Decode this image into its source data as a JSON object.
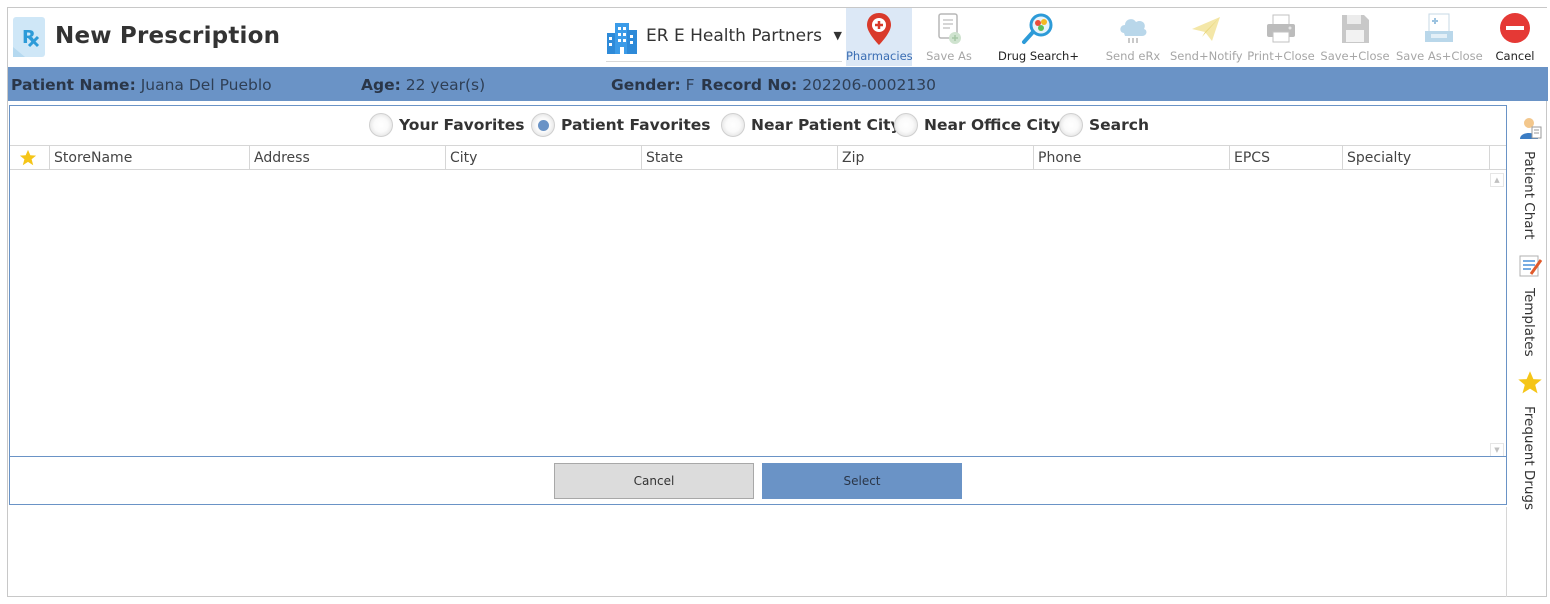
{
  "header": {
    "title": "New Prescription",
    "practice": "ER E Health Partners"
  },
  "toolbar": [
    {
      "label": "Pharmacies",
      "icon": "pharmacy-pin-icon",
      "state": "active"
    },
    {
      "label": "Save As",
      "icon": "save-as-document-icon",
      "state": "disabled"
    },
    {
      "label": "Drug Search+",
      "icon": "drug-search-icon",
      "state": "enabled"
    },
    {
      "label": "Send eRx",
      "icon": "send-erx-cloud-icon",
      "state": "disabled"
    },
    {
      "label": "Send+Notify",
      "icon": "paper-plane-icon",
      "state": "disabled"
    },
    {
      "label": "Print+Close",
      "icon": "printer-icon",
      "state": "disabled"
    },
    {
      "label": "Save+Close",
      "icon": "floppy-disk-icon",
      "state": "disabled"
    },
    {
      "label": "Save As+Close",
      "icon": "save-as-close-icon",
      "state": "disabled"
    },
    {
      "label": "Cancel",
      "icon": "cancel-icon",
      "state": "enabled"
    }
  ],
  "patient": {
    "name_label": "Patient Name:",
    "name": "Juana Del Pueblo",
    "age_label": "Age:",
    "age": "22 year(s)",
    "gender_label": "Gender:",
    "gender": "F",
    "record_label": "Record No:",
    "record": "202206-0002130"
  },
  "filters": [
    {
      "label": "Your Favorites",
      "checked": false
    },
    {
      "label": "Patient Favorites",
      "checked": true
    },
    {
      "label": "Near Patient City",
      "checked": false
    },
    {
      "label": "Near Office City",
      "checked": false
    },
    {
      "label": "Search",
      "checked": false
    }
  ],
  "table": {
    "columns": [
      "StoreName",
      "Address",
      "City",
      "State",
      "Zip",
      "Phone",
      "EPCS",
      "Specialty"
    ],
    "rows": []
  },
  "actions": {
    "cancel": "Cancel",
    "select": "Select"
  },
  "side_tabs": [
    {
      "label": "Patient Chart",
      "icon": "patient-chart-icon"
    },
    {
      "label": "Templates",
      "icon": "templates-icon"
    },
    {
      "label": "Frequent Drugs",
      "icon": "star-icon"
    }
  ],
  "colors": {
    "accent": "#6a93c6",
    "active_toolbar_bg": "#dce8f6",
    "cancel_red": "#e53935",
    "star_yellow": "#f5c518"
  }
}
